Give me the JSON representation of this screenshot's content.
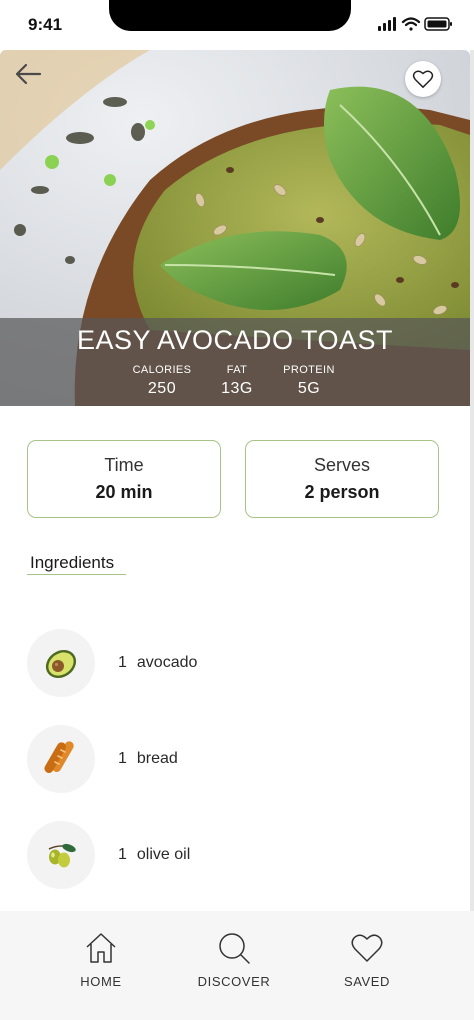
{
  "status": {
    "time": "9:41"
  },
  "recipe": {
    "title": "EASY AVOCADO TOAST",
    "macros": [
      {
        "label": "CALORIES",
        "value": "250"
      },
      {
        "label": "FAT",
        "value": "13G"
      },
      {
        "label": "PROTEIN",
        "value": "5G"
      }
    ],
    "time": {
      "label": "Time",
      "value": "20 min"
    },
    "serves": {
      "label": "Serves",
      "value": "2 person"
    }
  },
  "ingredients": {
    "title": "Ingredients",
    "items": [
      {
        "qty": "1",
        "name": "avocado",
        "icon": "avocado-icon"
      },
      {
        "qty": "1",
        "name": "bread",
        "icon": "bread-icon"
      },
      {
        "qty": "1",
        "name": "olive oil",
        "icon": "olive-icon"
      }
    ]
  },
  "nav": {
    "home": "HOME",
    "discover": "DISCOVER",
    "saved": "SAVED"
  },
  "colors": {
    "accent_border": "#a8c38a",
    "overlay": "#585858",
    "nav_bg": "#f6f6f6"
  }
}
